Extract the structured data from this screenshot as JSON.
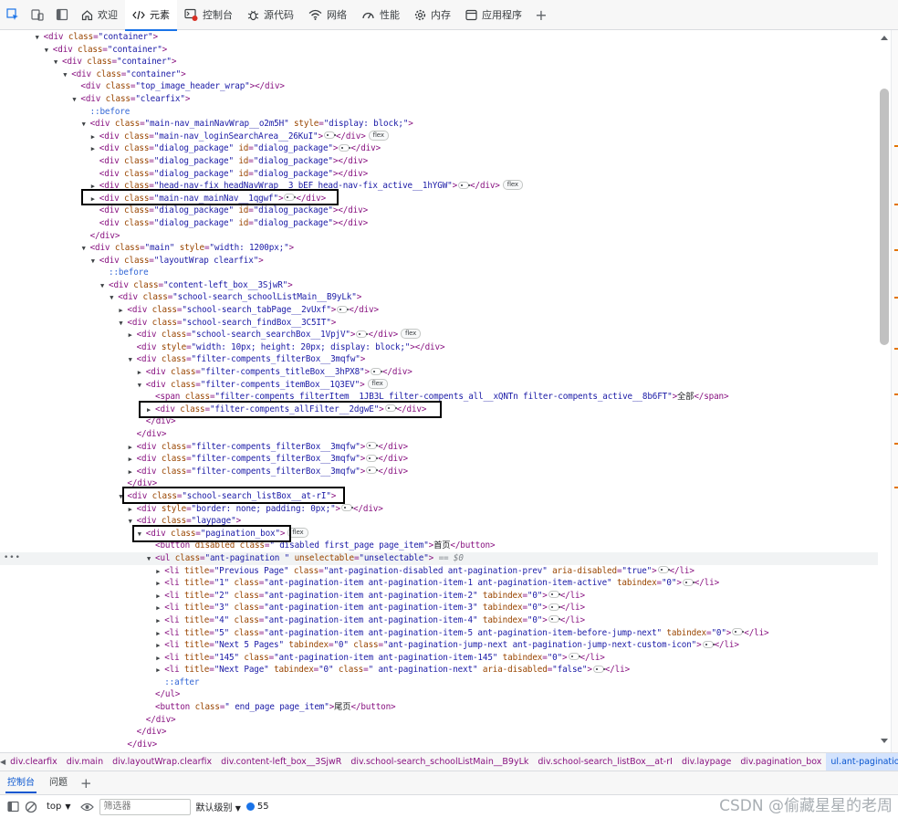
{
  "toolbar": {
    "tabs": [
      {
        "label": "欢迎",
        "icon": "home-icon"
      },
      {
        "label": "元素",
        "icon": "code-icon"
      },
      {
        "label": "控制台",
        "icon": "console-icon"
      },
      {
        "label": "源代码",
        "icon": "bug-icon"
      },
      {
        "label": "网络",
        "icon": "wifi-icon"
      },
      {
        "label": "性能",
        "icon": "gauge-icon"
      },
      {
        "label": "内存",
        "icon": "gear-icon"
      },
      {
        "label": "应用程序",
        "icon": "window-icon"
      }
    ],
    "active_tab": "元素"
  },
  "tree": {
    "lines": [
      {
        "indent": 3,
        "tri": "▼",
        "html": "<div class=\"container\">"
      },
      {
        "indent": 4,
        "tri": "▼",
        "html": "<div class=\"container\">"
      },
      {
        "indent": 5,
        "tri": "▼",
        "html": "<div class=\"container\">"
      },
      {
        "indent": 6,
        "tri": "▼",
        "html": "<div class=\"container\">"
      },
      {
        "indent": 7,
        "tri": "",
        "html": "<div class=\"top_image_header_wrap\"></div>"
      },
      {
        "indent": 7,
        "tri": "▼",
        "html": "<div class=\"clearfix\">"
      },
      {
        "indent": 8,
        "tri": "",
        "pseudo": "::before"
      },
      {
        "indent": 8,
        "tri": "▼",
        "html": "<div class=\"main-nav_mainNavWrap__o2m5H\" style=\"display: block;\">"
      },
      {
        "indent": 9,
        "tri": "▶",
        "html": "<div class=\"main-nav_loginSearchArea__26KuI\">",
        "ell": true,
        "close": "</div>",
        "badge": "flex"
      },
      {
        "indent": 9,
        "tri": "▶",
        "html": "<div class=\"dialog_package\" id=\"dialog_package\">",
        "ell": true,
        "close": "</div>"
      },
      {
        "indent": 9,
        "tri": "",
        "html": "<div class=\"dialog_package\" id=\"dialog_package\"></div>"
      },
      {
        "indent": 9,
        "tri": "",
        "html": "<div class=\"dialog_package\" id=\"dialog_package\"></div>"
      },
      {
        "indent": 9,
        "tri": "▶",
        "html": "<div class=\"head-nav-fix headNavWrap__3_bEF head-nav-fix_active__1hYGW\">",
        "ell": true,
        "close": "</div>",
        "badge": "flex"
      },
      {
        "indent": 9,
        "tri": "▶",
        "html": "<div class=\"main-nav_mainNav__1qgwf\">",
        "ell": true,
        "close": "</div>"
      },
      {
        "indent": 9,
        "tri": "",
        "html": "<div class=\"dialog_package\" id=\"dialog_package\"></div>"
      },
      {
        "indent": 9,
        "tri": "",
        "html": "<div class=\"dialog_package\" id=\"dialog_package\"></div>"
      },
      {
        "indent": 8,
        "tri": "",
        "html": "</div>"
      },
      {
        "indent": 8,
        "tri": "▼",
        "html": "<div class=\"main\" style=\"width: 1200px;\">"
      },
      {
        "indent": 9,
        "tri": "▼",
        "html": "<div class=\"layoutWrap clearfix\">"
      },
      {
        "indent": 10,
        "tri": "",
        "pseudo": "::before"
      },
      {
        "indent": 10,
        "tri": "▼",
        "html": "<div class=\"content-left_box__3SjwR\">"
      },
      {
        "indent": 11,
        "tri": "▼",
        "html": "<div class=\"school-search_schoolListMain__B9yLk\">"
      },
      {
        "indent": 12,
        "tri": "▶",
        "html": "<div class=\"school-search_tabPage__2vUxf\">",
        "ell": true,
        "close": "</div>"
      },
      {
        "indent": 12,
        "tri": "▼",
        "html": "<div class=\"school-search_findBox__3C5IT\">"
      },
      {
        "indent": 13,
        "tri": "▶",
        "html": "<div class=\"school-search_searchBox__1VpjV\">",
        "ell": true,
        "close": "</div>",
        "badge": "flex"
      },
      {
        "indent": 13,
        "tri": "",
        "html": "<div style=\"width: 10px; height: 20px; display: block;\"></div>"
      },
      {
        "indent": 13,
        "tri": "▼",
        "html": "<div class=\"filter-compents_filterBox__3mqfw\">"
      },
      {
        "indent": 14,
        "tri": "▶",
        "html": "<div class=\"filter-compents_titleBox__3hPX8\">",
        "ell": true,
        "close": "</div>"
      },
      {
        "indent": 14,
        "tri": "▼",
        "html": "<div class=\"filter-compents_itemBox__1Q3EV\">",
        "badge": "flex"
      },
      {
        "indent": 15,
        "tri": "",
        "html": "<span class=\"filter-compents_filterItem__1JB3L filter-compents_all__xQNTn filter-compents_active__8b6FT\">",
        "text": "全部",
        "close": "</span>"
      },
      {
        "indent": 15,
        "tri": "▶",
        "html": "<div class=\"filter-compents_allFilter__2dgwE\">",
        "ell": true,
        "close": "</div>"
      },
      {
        "indent": 14,
        "tri": "",
        "html": "</div>"
      },
      {
        "indent": 13,
        "tri": "",
        "html": "</div>"
      },
      {
        "indent": 13,
        "tri": "▶",
        "html": "<div class=\"filter-compents_filterBox__3mqfw\">",
        "ell": true,
        "close": "</div>"
      },
      {
        "indent": 13,
        "tri": "▶",
        "html": "<div class=\"filter-compents_filterBox__3mqfw\">",
        "ell": true,
        "close": "</div>"
      },
      {
        "indent": 13,
        "tri": "▶",
        "html": "<div class=\"filter-compents_filterBox__3mqfw\">",
        "ell": true,
        "close": "</div>"
      },
      {
        "indent": 12,
        "tri": "",
        "html": "</div>"
      },
      {
        "indent": 12,
        "tri": "▼",
        "html": "<div class=\"school-search_listBox__at-rI\">"
      },
      {
        "indent": 13,
        "tri": "▶",
        "html": "<div style=\"border: none; padding: 0px;\">",
        "ell": true,
        "close": "</div>"
      },
      {
        "indent": 13,
        "tri": "▼",
        "html": "<div class=\"laypage\">"
      },
      {
        "indent": 14,
        "tri": "▼",
        "html": "<div class=\"pagination_box\">",
        "badge": "flex"
      },
      {
        "indent": 15,
        "tri": "",
        "html": "<button disabled class=\" disabled first_page page_item\">",
        "text": "首页",
        "close": "</button>"
      },
      {
        "indent": 15,
        "tri": "▼",
        "html": "<ul class=\"ant-pagination \" unselectable=\"unselectable\">",
        "eq": "== $0",
        "selected": true
      },
      {
        "indent": 16,
        "tri": "▶",
        "html": "<li title=\"Previous Page\" class=\"ant-pagination-disabled ant-pagination-prev\" aria-disabled=\"true\">",
        "ell": true,
        "close": "</li>"
      },
      {
        "indent": 16,
        "tri": "▶",
        "html": "<li title=\"1\" class=\"ant-pagination-item ant-pagination-item-1 ant-pagination-item-active\" tabindex=\"0\">",
        "ell": true,
        "close": "</li>"
      },
      {
        "indent": 16,
        "tri": "▶",
        "html": "<li title=\"2\" class=\"ant-pagination-item ant-pagination-item-2\" tabindex=\"0\">",
        "ell": true,
        "close": "</li>"
      },
      {
        "indent": 16,
        "tri": "▶",
        "html": "<li title=\"3\" class=\"ant-pagination-item ant-pagination-item-3\" tabindex=\"0\">",
        "ell": true,
        "close": "</li>"
      },
      {
        "indent": 16,
        "tri": "▶",
        "html": "<li title=\"4\" class=\"ant-pagination-item ant-pagination-item-4\" tabindex=\"0\">",
        "ell": true,
        "close": "</li>"
      },
      {
        "indent": 16,
        "tri": "▶",
        "html": "<li title=\"5\" class=\"ant-pagination-item ant-pagination-item-5 ant-pagination-item-before-jump-next\" tabindex=\"0\">",
        "ell": true,
        "close": "</li>"
      },
      {
        "indent": 16,
        "tri": "▶",
        "html": "<li title=\"Next 5 Pages\" tabindex=\"0\" class=\"ant-pagination-jump-next ant-pagination-jump-next-custom-icon\">",
        "ell": true,
        "close": "</li>"
      },
      {
        "indent": 16,
        "tri": "▶",
        "html": "<li title=\"145\" class=\"ant-pagination-item ant-pagination-item-145\" tabindex=\"0\">",
        "ell": true,
        "close": "</li>"
      },
      {
        "indent": 16,
        "tri": "▶",
        "html": "<li title=\"Next Page\" tabindex=\"0\" class=\" ant-pagination-next\" aria-disabled=\"false\">",
        "ell": true,
        "close": "</li>"
      },
      {
        "indent": 16,
        "tri": "",
        "pseudo": "::after"
      },
      {
        "indent": 15,
        "tri": "",
        "html": "</ul>"
      },
      {
        "indent": 15,
        "tri": "",
        "html": "<button class=\" end_page page_item\">",
        "text": "尾页",
        "close": "</button>"
      },
      {
        "indent": 14,
        "tri": "",
        "html": "</div>"
      },
      {
        "indent": 13,
        "tri": "",
        "html": "</div>"
      },
      {
        "indent": 12,
        "tri": "",
        "html": "</div>"
      }
    ]
  },
  "breadcrumbs": [
    "div.clearfix",
    "div.main",
    "div.layoutWrap.clearfix",
    "div.content-left_box__3SjwR",
    "div.school-search_schoolListMain__B9yLk",
    "div.school-search_listBox__at-rI",
    "div.laypage",
    "div.pagination_box",
    "ul.ant-pagination."
  ],
  "drawer": {
    "tabs": [
      "控制台",
      "问题"
    ]
  },
  "console_toolbar": {
    "context": "top",
    "filter_placeholder": "筛选器",
    "level": "默认级别",
    "message_count": "55"
  },
  "watermark": "CSDN @偷藏星星的老周"
}
